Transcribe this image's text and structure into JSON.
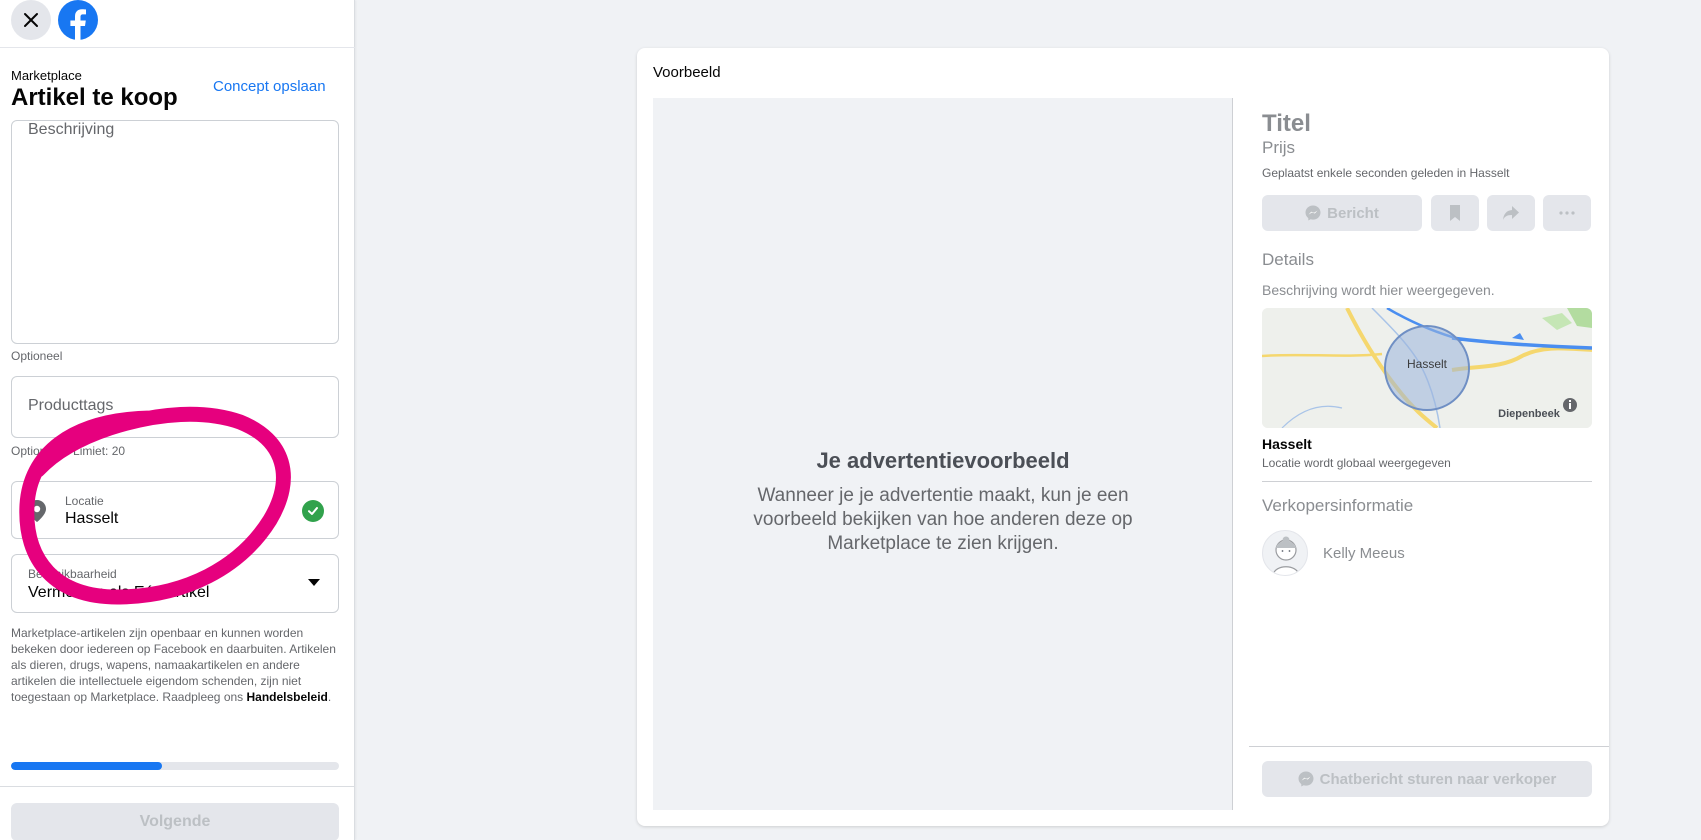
{
  "header": {
    "close_icon": "close-icon",
    "logo_icon": "facebook-logo-icon",
    "breadcrumb": "Marketplace",
    "title": "Artikel te koop",
    "save_draft_label": "Concept opslaan"
  },
  "form": {
    "description": {
      "placeholder": "Beschrijving",
      "hint": "Optioneel"
    },
    "tags": {
      "placeholder": "Producttags",
      "hint": "Optioneel · Limiet: 20"
    },
    "location": {
      "label": "Locatie",
      "value": "Hasselt",
      "icon": "location-pin-icon",
      "status_icon": "check-circle-icon"
    },
    "availability": {
      "label": "Beschikbaarheid",
      "value": "Vermelden als Eén artikel",
      "icon": "dropdown-caret-icon"
    },
    "policy_text": "Marketplace-artikelen zijn openbaar en kunnen worden bekeken door iedereen op Facebook en daarbuiten. Artikelen als dieren, drugs, wapens, namaakartikelen en andere artikelen die intellectuele eigendom schenden, zijn niet toegestaan op Marketplace. Raadpleeg ons ",
    "policy_link": "Handelsbeleid",
    "policy_end": "."
  },
  "progress": {
    "fraction": 0.46
  },
  "footer": {
    "next_label": "Volgende"
  },
  "colors": {
    "accent": "#1877f2",
    "annotation": "#e6007e",
    "success": "#31a24c"
  },
  "preview": {
    "heading": "Voorbeeld",
    "placeholder_title": "Je advertentievoorbeeld",
    "placeholder_body": "Wanneer je je advertentie maakt, kun je een voorbeeld bekijken van hoe anderen deze op Marketplace te zien krijgen.",
    "item_title": "Titel",
    "item_price": "Prijs",
    "posted": "Geplaatst enkele seconden geleden in Hasselt",
    "message_label": "Bericht",
    "details_heading": "Details",
    "details_text": "Beschrijving wordt hier weergegeven.",
    "map_city": "Hasselt",
    "map_town": "Diepenbeek",
    "location_name": "Hasselt",
    "location_note": "Locatie wordt globaal weergegeven",
    "seller_heading": "Verkopersinformatie",
    "seller_name": "Kelly Meeus",
    "chat_label": "Chatbericht sturen naar verkoper"
  }
}
